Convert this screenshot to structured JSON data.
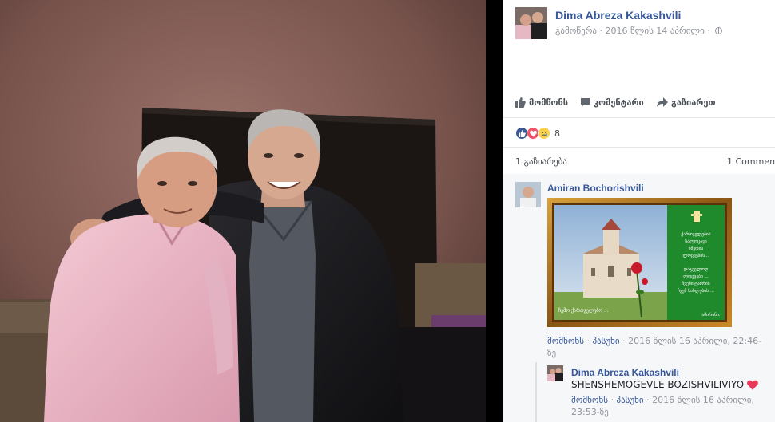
{
  "post": {
    "author": "Dima Abreza Kakashvili",
    "meta_prefix": "გამოწერა · ",
    "timestamp": "2016 წლის 14 აპრილი",
    "meta_suffix": " · "
  },
  "actions": {
    "like": "მომწონს",
    "comment": "კომენტარი",
    "share": "გაზიარეთ"
  },
  "reactions": {
    "count": "8",
    "types": [
      "like-icon",
      "love-icon",
      "sad-icon"
    ]
  },
  "stats": {
    "shares": "1 გაზიარება",
    "comments": "1 Comment"
  },
  "comment1": {
    "author": "Amiran Bochorishvili",
    "image_caption_left": "ჩემო ქართველებო ...",
    "image_poem": "ქართველების\nსალოცავი\nიმედია\nლოცვების...\n\nდაგველოდ\nლოცვები ...\nჩვენი ტაძრის\nჩვენ სახლების ...",
    "image_signature": "ამირანი.",
    "like_label": "მომწონს",
    "reply_label": "პასუხი",
    "timestamp_line1": "2016 წლის 16 აპრილი, 22:46-",
    "timestamp_line2": "ზე"
  },
  "reply": {
    "author": "Dima Abreza Kakashvili",
    "text": "SHENSHEMOGEVLE BOZISHVILIVIYO",
    "like_label": "მომწონს",
    "reply_label": "პასუხი",
    "timestamp_line1": "2016 წლის 16 აპრილი,",
    "timestamp_line2": "23:53-ზე"
  },
  "colors": {
    "link": "#365899",
    "secondary": "#90949c",
    "text": "#1d2129",
    "like_blue": "#3b5998",
    "love_red": "#f25268",
    "sad_yellow": "#fbd14b"
  }
}
